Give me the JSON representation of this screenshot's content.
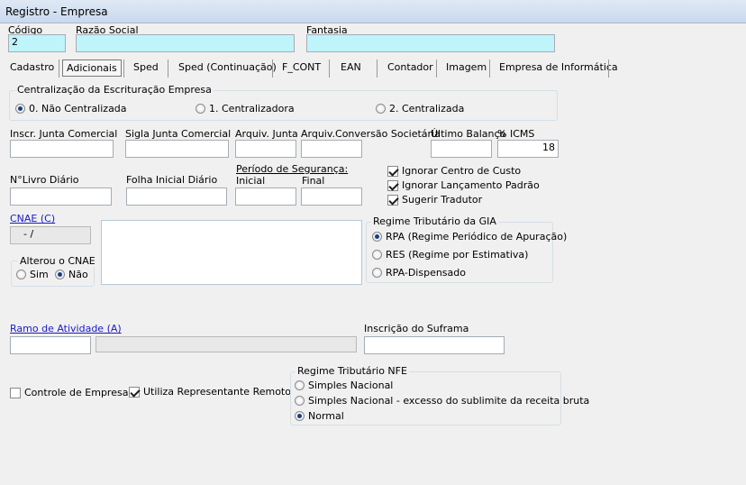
{
  "window": {
    "title": "Registro - Empresa"
  },
  "header": {
    "codigo_label": "Código",
    "codigo_value": "2",
    "razao_label": "Razão Social",
    "razao_value": "",
    "fantasia_label": "Fantasia",
    "fantasia_value": ""
  },
  "tabs": [
    {
      "label": "Cadastro"
    },
    {
      "label": "Adicionais"
    },
    {
      "label": "Sped"
    },
    {
      "label": "Sped (Continuação)"
    },
    {
      "label": "F_CONT"
    },
    {
      "label": "EAN"
    },
    {
      "label": "Contador"
    },
    {
      "label": "Imagem"
    },
    {
      "label": "Empresa de Informática"
    }
  ],
  "active_tab": "Adicionais",
  "centralizacao": {
    "title": "Centralização da Escrituração Empresa",
    "options": [
      {
        "label": "0. Não Centralizada",
        "selected": true
      },
      {
        "label": "1. Centralizadora",
        "selected": false
      },
      {
        "label": "2. Centralizada",
        "selected": false
      }
    ]
  },
  "registro": {
    "inscr_junta_label": "Inscr. Junta Comercial",
    "inscr_junta_value": "",
    "sigla_junta_label": "Sigla Junta Comercial",
    "sigla_junta_value": "",
    "arquiv_junta_label": "Arquiv. Junta",
    "arquiv_junta_value": "",
    "arquiv_conv_label": "Arquiv.Conversão Societária",
    "arquiv_conv_value": "",
    "ultimo_balanco_label": "Último Balanço",
    "ultimo_balanco_value": "",
    "icms_label": "% ICMS",
    "icms_value": "18"
  },
  "livro": {
    "nlivro_label": "N°Livro Diário",
    "nlivro_value": "",
    "folha_label": "Folha Inicial Diário",
    "folha_value": "",
    "periodo_label": "Período de Segurança:",
    "inicial_label": "Inicial",
    "inicial_value": "",
    "final_label": "Final",
    "final_value": ""
  },
  "options": {
    "ignorar_centro_custo": {
      "label": "Ignorar Centro de Custo",
      "checked": true
    },
    "ignorar_lancamento": {
      "label": "Ignorar Lançamento Padrão",
      "checked": true
    },
    "sugerir_tradutor": {
      "label": "Sugerir Tradutor",
      "checked": true
    }
  },
  "cnae": {
    "label": "CNAE (C)",
    "value": "- /",
    "description": "",
    "alterou_title": "Alterou o CNAE",
    "sim_label": "Sim",
    "nao_label": "Não",
    "alterou_selected": "Não"
  },
  "gia": {
    "title": "Regime Tributário da GIA",
    "options": [
      {
        "label": "RPA (Regime Periódico de Apuração)",
        "selected": true
      },
      {
        "label": "RES (Regime por Estimativa)",
        "selected": false
      },
      {
        "label": "RPA-Dispensado",
        "selected": false
      }
    ]
  },
  "ramo": {
    "label": "Ramo de Atividade (A)",
    "code_value": "",
    "desc_value": "",
    "suframa_label": "Inscrição do Suframa",
    "suframa_value": ""
  },
  "bottom": {
    "controle_empresa": {
      "label": "Controle de Empresa",
      "checked": false
    },
    "utiliza_representante": {
      "label": "Utiliza Representante Remoto",
      "checked": true
    }
  },
  "nfe": {
    "title": "Regime Tributário NFE",
    "options": [
      {
        "label": "Simples Nacional",
        "selected": false
      },
      {
        "label": "Simples Nacional - excesso do sublimite da receita bruta",
        "selected": false
      },
      {
        "label": "Normal",
        "selected": true
      }
    ]
  }
}
